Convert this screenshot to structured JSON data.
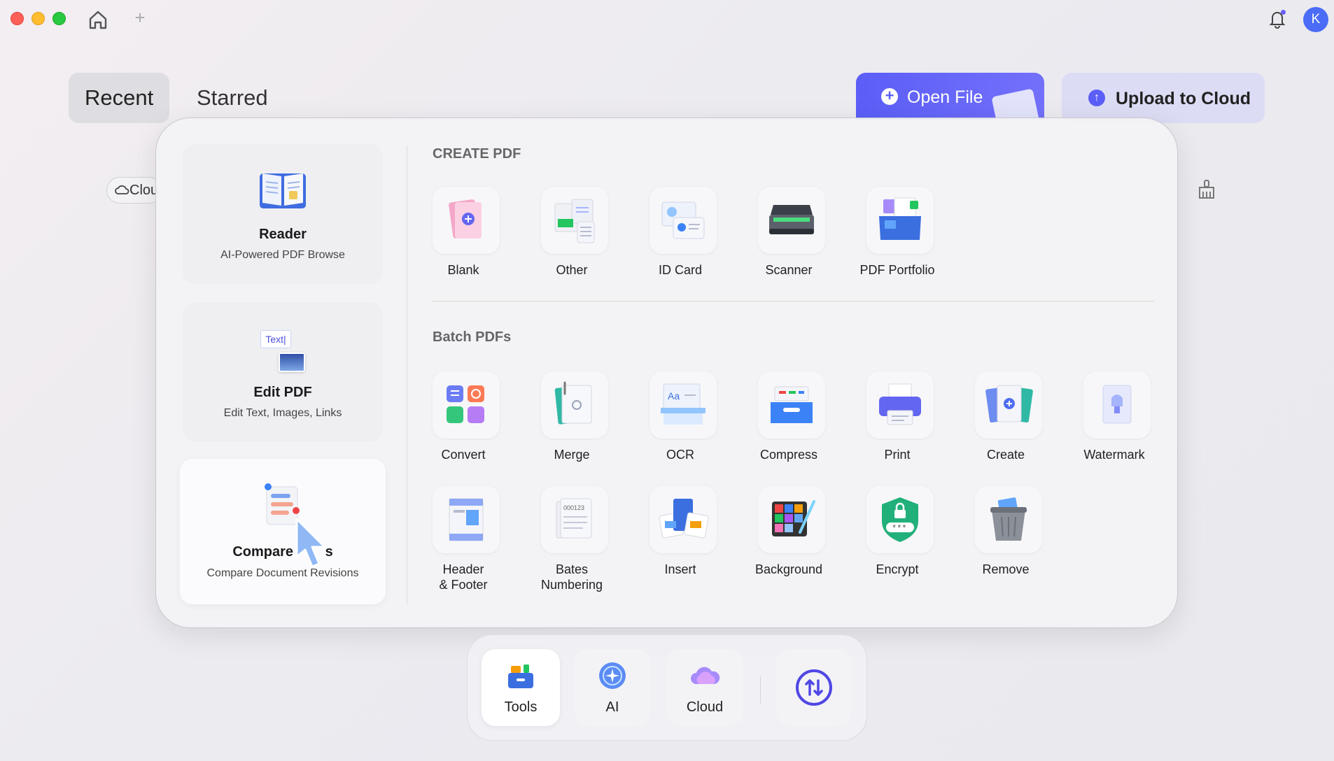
{
  "titlebar": {
    "avatar_letter": "K",
    "new_tab_symbol": "+"
  },
  "tabs": {
    "recent": "Recent",
    "starred": "Starred"
  },
  "actions": {
    "open_file": "Open File",
    "upload": "Upload to Cloud"
  },
  "filter": {
    "cloud_partial": "Clou"
  },
  "left_cards": [
    {
      "title": "Reader",
      "subtitle": "AI-Powered PDF Browse"
    },
    {
      "title": "Edit PDF",
      "subtitle": "Edit Text, Images, Links",
      "icon_text": "Text|"
    },
    {
      "title_visible_start": "Compare ",
      "title_visible_end": "s",
      "subtitle": "Compare Document Revisions"
    }
  ],
  "sections": {
    "create": "CREATE PDF",
    "batch": "Batch PDFs"
  },
  "create_tools": [
    {
      "label": "Blank",
      "icon": "blank-page-icon"
    },
    {
      "label": "Other",
      "icon": "other-formats-icon"
    },
    {
      "label": "ID Card",
      "icon": "id-card-icon"
    },
    {
      "label": "Scanner",
      "icon": "scanner-icon"
    },
    {
      "label": "PDF Portfolio",
      "icon": "portfolio-icon"
    }
  ],
  "batch_tools": [
    {
      "label": "Convert",
      "icon": "convert-icon"
    },
    {
      "label": "Merge",
      "icon": "merge-icon"
    },
    {
      "label": "OCR",
      "icon": "ocr-icon"
    },
    {
      "label": "Compress",
      "icon": "compress-icon"
    },
    {
      "label": "Print",
      "icon": "print-icon"
    },
    {
      "label": "Create",
      "icon": "create-icon"
    },
    {
      "label": "Watermark",
      "icon": "watermark-icon"
    },
    {
      "label": "Header\n& Footer",
      "icon": "header-footer-icon"
    },
    {
      "label": "Bates\nNumbering",
      "icon": "bates-numbering-icon"
    },
    {
      "label": "Insert",
      "icon": "insert-icon"
    },
    {
      "label": "Background",
      "icon": "background-icon"
    },
    {
      "label": "Encrypt",
      "icon": "encrypt-icon"
    },
    {
      "label": "Remove",
      "icon": "remove-icon"
    }
  ],
  "icon_text": {
    "ocr": "Aa",
    "bates": "000123",
    "encrypt": "***"
  },
  "dock": {
    "tools": "Tools",
    "ai": "AI",
    "cloud": "Cloud"
  },
  "colors": {
    "accent": "#5b5ef7",
    "avatar": "#4a6cf7"
  }
}
